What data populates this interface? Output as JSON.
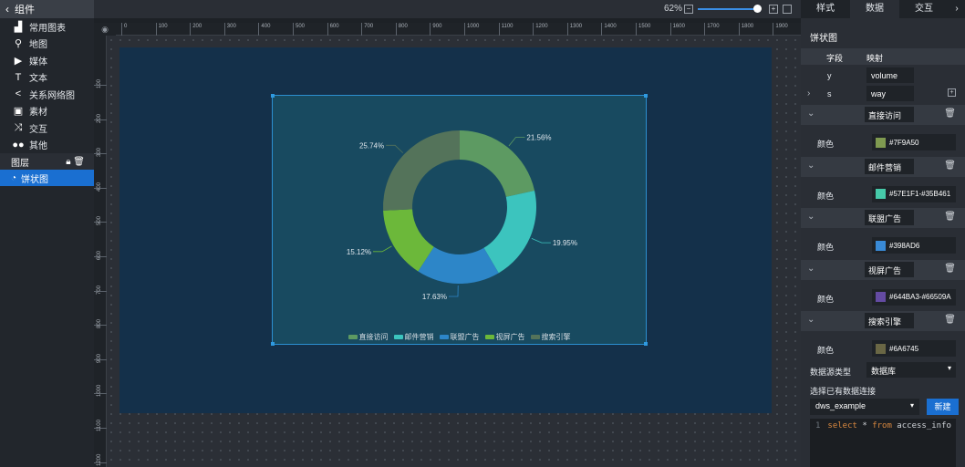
{
  "left": {
    "header": "组件",
    "items": [
      {
        "icon": "chart-icon",
        "label": "常用图表"
      },
      {
        "icon": "map-pin-icon",
        "label": "地图"
      },
      {
        "icon": "media-icon",
        "label": "媒体"
      },
      {
        "icon": "text-icon",
        "label": "文本"
      },
      {
        "icon": "share-icon",
        "label": "关系网络图"
      },
      {
        "icon": "material-icon",
        "label": "素材"
      },
      {
        "icon": "shuffle-icon",
        "label": "交互"
      },
      {
        "icon": "dots-icon",
        "label": "其他"
      }
    ],
    "layers_label": "图层",
    "selected_layer": "饼状图"
  },
  "toolbar": {
    "zoom": "62%"
  },
  "ruler": {
    "h": [
      "0",
      "100",
      "200",
      "300",
      "400",
      "500",
      "600",
      "700",
      "800",
      "900",
      "1000",
      "1100",
      "1200",
      "1300",
      "1400",
      "1500",
      "1600",
      "1700",
      "1800",
      "1900"
    ],
    "v": [
      "100",
      "200",
      "300",
      "400",
      "500",
      "600",
      "700",
      "800",
      "900",
      "1000",
      "1100",
      "1200"
    ]
  },
  "right": {
    "tabs": [
      "样式",
      "数据",
      "交互"
    ],
    "active_tab": "数据",
    "section_title": "饼状图",
    "col_field": "字段",
    "col_map": "映射",
    "y_label": "y",
    "y_value": "volume",
    "s_label": "s",
    "s_value": "way",
    "color_label": "颜色",
    "series": [
      {
        "name": "直接访问",
        "color": "#7F9A50",
        "swatch": "#7f9a50"
      },
      {
        "name": "邮件营销",
        "color": "#57E1F1-#35B461",
        "swatch": "#46c9a9"
      },
      {
        "name": "联盟广告",
        "color": "#398AD6",
        "swatch": "#398ad6"
      },
      {
        "name": "视屏广告",
        "color": "#644BA3-#66509A",
        "swatch": "#644ba3"
      },
      {
        "name": "搜索引擎",
        "color": "#6A6745",
        "swatch": "#6a6745"
      }
    ],
    "ds_type_label": "数据源类型",
    "ds_type_value": "数据库",
    "conn_label": "选择已有数据连接",
    "conn_value": "dws_example",
    "new_button": "新建",
    "code_line_no": "1",
    "code_kw1": "select",
    "code_star": " * ",
    "code_kw2": "from",
    "code_rest": " access_info"
  },
  "chart_data": {
    "type": "pie",
    "variant": "donut",
    "categories": [
      "直接访问",
      "邮件营销",
      "联盟广告",
      "视屏广告",
      "搜索引擎"
    ],
    "values": [
      21.56,
      19.95,
      17.63,
      15.12,
      25.74
    ],
    "labels": [
      "21.56%",
      "19.95%",
      "17.63%",
      "15.12%",
      "25.74%"
    ],
    "colors": [
      "#5d9a62",
      "#3cc4be",
      "#2d86c8",
      "#6cb83a",
      "#54735a"
    ],
    "legend_position": "bottom"
  }
}
